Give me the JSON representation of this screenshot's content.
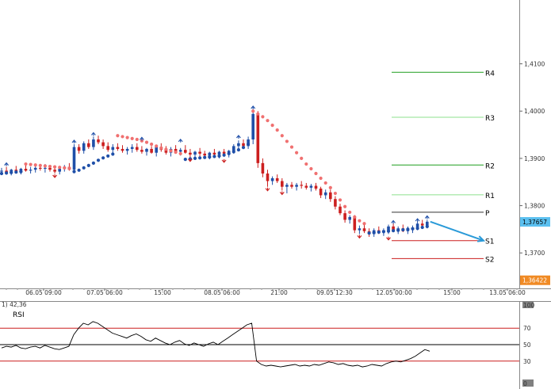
{
  "chart_data": {
    "type": "candlestick",
    "instrument": "",
    "price_axis": {
      "ticks": [
        "1,4100",
        "1,4000",
        "1,3900",
        "1,3800",
        "1,3700"
      ],
      "range": [
        1.3625,
        1.4235
      ]
    },
    "time_axis": {
      "ticks": [
        "06.05 09:00",
        "07.05 06:00",
        "15:00",
        "08.05 06:00",
        "21:00",
        "09.05 12:30",
        "12.05 00:00",
        "15:00",
        "13.05 06:00"
      ]
    },
    "current_price": {
      "label": "1,37657",
      "color": "#5bc0f0"
    },
    "marker_price": {
      "label": "1,36422",
      "color": "#f08a24"
    },
    "pivot_levels": [
      {
        "name": "R4",
        "value": 1.4082,
        "color": "#1e9e1e"
      },
      {
        "name": "R3",
        "value": 1.3987,
        "color": "#8ee08e"
      },
      {
        "name": "R2",
        "value": 1.3886,
        "color": "#1e9e1e"
      },
      {
        "name": "R1",
        "value": 1.3823,
        "color": "#8ee08e"
      },
      {
        "name": "P",
        "value": 1.3786,
        "color": "#333333"
      },
      {
        "name": "S1",
        "value": 1.3726,
        "color": "#cc1f1f"
      },
      {
        "name": "S2",
        "value": 1.3688,
        "color": "#cc1f1f"
      }
    ],
    "series": [
      {
        "kind": "ohlc",
        "up_color": "#1f4fa8",
        "down_color": "#cc1f1f",
        "bars": [
          [
            1.3872,
            1.388,
            1.3866,
            1.3874
          ],
          [
            1.3874,
            1.3882,
            1.3868,
            1.387
          ],
          [
            1.387,
            1.3878,
            1.3864,
            1.3876
          ],
          [
            1.3876,
            1.3884,
            1.387,
            1.3872
          ],
          [
            1.3872,
            1.388,
            1.3866,
            1.3878
          ],
          [
            1.3878,
            1.3886,
            1.3872,
            1.3874
          ],
          [
            1.3874,
            1.3882,
            1.3868,
            1.3876
          ],
          [
            1.3876,
            1.3884,
            1.387,
            1.388
          ],
          [
            1.388,
            1.3888,
            1.3874,
            1.3878
          ],
          [
            1.3878,
            1.3888,
            1.387,
            1.388
          ],
          [
            1.388,
            1.3886,
            1.3872,
            1.3876
          ],
          [
            1.3876,
            1.3882,
            1.3868,
            1.3872
          ],
          [
            1.3872,
            1.388,
            1.3866,
            1.3878
          ],
          [
            1.3878,
            1.3886,
            1.3872,
            1.3882
          ],
          [
            1.3882,
            1.389,
            1.3874,
            1.3876
          ],
          [
            1.3876,
            1.393,
            1.387,
            1.3924
          ],
          [
            1.3924,
            1.393,
            1.391,
            1.3916
          ],
          [
            1.3916,
            1.3936,
            1.391,
            1.3932
          ],
          [
            1.3932,
            1.394,
            1.392,
            1.3924
          ],
          [
            1.3924,
            1.3946,
            1.3918,
            1.394
          ],
          [
            1.394,
            1.3948,
            1.393,
            1.3934
          ],
          [
            1.3934,
            1.394,
            1.392,
            1.3926
          ],
          [
            1.3926,
            1.3934,
            1.3914,
            1.3918
          ],
          [
            1.3918,
            1.393,
            1.391,
            1.3924
          ],
          [
            1.3924,
            1.3932,
            1.3916,
            1.392
          ],
          [
            1.392,
            1.3928,
            1.3912,
            1.3916
          ],
          [
            1.3916,
            1.3924,
            1.3908,
            1.392
          ],
          [
            1.392,
            1.393,
            1.3912,
            1.3924
          ],
          [
            1.3924,
            1.3932,
            1.3914,
            1.3918
          ],
          [
            1.3918,
            1.3926,
            1.391,
            1.3914
          ],
          [
            1.3914,
            1.3922,
            1.3906,
            1.392
          ],
          [
            1.392,
            1.3926,
            1.391,
            1.3912
          ],
          [
            1.3912,
            1.3928,
            1.3904,
            1.3924
          ],
          [
            1.3924,
            1.3932,
            1.3914,
            1.3918
          ],
          [
            1.3918,
            1.3926,
            1.3908,
            1.3912
          ],
          [
            1.3912,
            1.3924,
            1.3904,
            1.392
          ],
          [
            1.392,
            1.3928,
            1.391,
            1.3914
          ],
          [
            1.3914,
            1.3922,
            1.3906,
            1.3918
          ],
          [
            1.3918,
            1.3928,
            1.391,
            1.3912
          ],
          [
            1.3912,
            1.392,
            1.3902,
            1.3908
          ],
          [
            1.3908,
            1.3916,
            1.39,
            1.3914
          ],
          [
            1.3914,
            1.3922,
            1.3904,
            1.391
          ],
          [
            1.391,
            1.3916,
            1.39,
            1.3906
          ],
          [
            1.3906,
            1.3914,
            1.3898,
            1.3912
          ],
          [
            1.3912,
            1.392,
            1.3902,
            1.3908
          ],
          [
            1.3908,
            1.3916,
            1.39,
            1.3914
          ],
          [
            1.3914,
            1.392,
            1.3904,
            1.391
          ],
          [
            1.391,
            1.3918,
            1.3902,
            1.3916
          ],
          [
            1.3916,
            1.393,
            1.391,
            1.3926
          ],
          [
            1.3926,
            1.3938,
            1.3918,
            1.3932
          ],
          [
            1.3932,
            1.394,
            1.3922,
            1.3926
          ],
          [
            1.3926,
            1.3946,
            1.392,
            1.394
          ],
          [
            1.394,
            1.4002,
            1.393,
            1.3994
          ],
          [
            1.3994,
            1.4,
            1.388,
            1.389
          ],
          [
            1.389,
            1.39,
            1.386,
            1.3868
          ],
          [
            1.3868,
            1.3876,
            1.384,
            1.3852
          ],
          [
            1.3852,
            1.3862,
            1.3844,
            1.3858
          ],
          [
            1.3858,
            1.3866,
            1.3848,
            1.3852
          ],
          [
            1.3852,
            1.3858,
            1.3832,
            1.384
          ],
          [
            1.384,
            1.3848,
            1.3826,
            1.3844
          ],
          [
            1.3844,
            1.385,
            1.3836,
            1.384
          ],
          [
            1.384,
            1.3848,
            1.3832,
            1.3844
          ],
          [
            1.3844,
            1.3852,
            1.3836,
            1.3842
          ],
          [
            1.3842,
            1.3848,
            1.3834,
            1.3838
          ],
          [
            1.3838,
            1.3846,
            1.383,
            1.3842
          ],
          [
            1.3842,
            1.3848,
            1.3832,
            1.3836
          ],
          [
            1.3836,
            1.384,
            1.3816,
            1.3822
          ],
          [
            1.3822,
            1.3834,
            1.3814,
            1.3828
          ],
          [
            1.3828,
            1.3834,
            1.3808,
            1.3814
          ],
          [
            1.3814,
            1.382,
            1.3792,
            1.3798
          ],
          [
            1.3798,
            1.3804,
            1.378,
            1.3784
          ],
          [
            1.3784,
            1.379,
            1.3764,
            1.377
          ],
          [
            1.377,
            1.378,
            1.3762,
            1.3776
          ],
          [
            1.3776,
            1.378,
            1.3742,
            1.3748
          ],
          [
            1.3748,
            1.3758,
            1.374,
            1.3752
          ],
          [
            1.3752,
            1.376,
            1.3742,
            1.3746
          ],
          [
            1.3746,
            1.3752,
            1.3734,
            1.374
          ],
          [
            1.374,
            1.3752,
            1.3734,
            1.3748
          ],
          [
            1.3748,
            1.3756,
            1.374,
            1.3744
          ],
          [
            1.3744,
            1.3752,
            1.3736,
            1.3748
          ],
          [
            1.3748,
            1.376,
            1.374,
            1.3756
          ],
          [
            1.3756,
            1.3762,
            1.3744,
            1.3748
          ],
          [
            1.3748,
            1.3756,
            1.374,
            1.3752
          ],
          [
            1.3752,
            1.376,
            1.3744,
            1.3746
          ],
          [
            1.3746,
            1.3756,
            1.374,
            1.375
          ],
          [
            1.375,
            1.3758,
            1.3742,
            1.3754
          ],
          [
            1.3754,
            1.3766,
            1.3748,
            1.3762
          ],
          [
            1.3762,
            1.377,
            1.3754,
            1.3758
          ],
          [
            1.3758,
            1.377,
            1.3752,
            1.3766
          ]
        ]
      },
      {
        "kind": "psar_up",
        "color": "#1f4fa8",
        "points": [
          [
            0,
            1.3868
          ],
          [
            1,
            1.3869
          ],
          [
            2,
            1.387
          ],
          [
            3,
            1.3871
          ],
          [
            4,
            1.3872
          ],
          [
            15,
            1.3872
          ],
          [
            16,
            1.3875
          ],
          [
            17,
            1.388
          ],
          [
            18,
            1.3885
          ],
          [
            19,
            1.389
          ],
          [
            20,
            1.3896
          ],
          [
            21,
            1.3901
          ],
          [
            22,
            1.3905
          ],
          [
            23,
            1.3909
          ],
          [
            38,
            1.3898
          ],
          [
            39,
            1.3899
          ],
          [
            40,
            1.39
          ],
          [
            41,
            1.3901
          ],
          [
            42,
            1.3902
          ],
          [
            43,
            1.3903
          ],
          [
            44,
            1.3904
          ],
          [
            45,
            1.3905
          ],
          [
            46,
            1.3907
          ],
          [
            47,
            1.391
          ],
          [
            48,
            1.3914
          ],
          [
            49,
            1.3918
          ],
          [
            50,
            1.3923
          ],
          [
            51,
            1.393
          ],
          [
            76,
            1.3742
          ],
          [
            77,
            1.3743
          ],
          [
            78,
            1.3744
          ],
          [
            79,
            1.3745
          ],
          [
            80,
            1.3746
          ],
          [
            81,
            1.3747
          ],
          [
            82,
            1.3748
          ],
          [
            83,
            1.3749
          ],
          [
            84,
            1.375
          ],
          [
            85,
            1.3751
          ],
          [
            86,
            1.3752
          ],
          [
            87,
            1.3754
          ],
          [
            88,
            1.3756
          ]
        ]
      },
      {
        "kind": "psar_down",
        "color": "#f07070",
        "points": [
          [
            5,
            1.3888
          ],
          [
            6,
            1.3887
          ],
          [
            7,
            1.3886
          ],
          [
            8,
            1.3885
          ],
          [
            9,
            1.3884
          ],
          [
            10,
            1.3883
          ],
          [
            11,
            1.3882
          ],
          [
            12,
            1.3881
          ],
          [
            13,
            1.388
          ],
          [
            14,
            1.3879
          ],
          [
            24,
            1.3948
          ],
          [
            25,
            1.3946
          ],
          [
            26,
            1.3944
          ],
          [
            27,
            1.3942
          ],
          [
            28,
            1.394
          ],
          [
            29,
            1.3937
          ],
          [
            30,
            1.3934
          ],
          [
            31,
            1.393
          ],
          [
            32,
            1.3926
          ],
          [
            33,
            1.3922
          ],
          [
            34,
            1.3919
          ],
          [
            35,
            1.3916
          ],
          [
            36,
            1.3913
          ],
          [
            37,
            1.391
          ],
          [
            52,
            1.4
          ],
          [
            53,
            1.3994
          ],
          [
            54,
            1.3988
          ],
          [
            55,
            1.398
          ],
          [
            56,
            1.397
          ],
          [
            57,
            1.396
          ],
          [
            58,
            1.3948
          ],
          [
            59,
            1.3936
          ],
          [
            60,
            1.3924
          ],
          [
            61,
            1.3912
          ],
          [
            62,
            1.39
          ],
          [
            63,
            1.3888
          ],
          [
            64,
            1.3878
          ],
          [
            65,
            1.3868
          ],
          [
            66,
            1.3858
          ],
          [
            67,
            1.3848
          ],
          [
            68,
            1.3838
          ],
          [
            69,
            1.3826
          ],
          [
            70,
            1.3812
          ],
          [
            71,
            1.3798
          ],
          [
            72,
            1.3786
          ],
          [
            73,
            1.3776
          ],
          [
            74,
            1.3768
          ],
          [
            75,
            1.3762
          ]
        ]
      },
      {
        "kind": "fractal_up",
        "color": "#1f4fa8",
        "points": [
          [
            1,
            1.3882
          ],
          [
            15,
            1.393
          ],
          [
            19,
            1.3946
          ],
          [
            29,
            1.3936
          ],
          [
            37,
            1.3932
          ],
          [
            49,
            1.394
          ],
          [
            52,
            1.4002
          ],
          [
            81,
            1.376
          ],
          [
            86,
            1.3764
          ],
          [
            88,
            1.377
          ]
        ]
      },
      {
        "kind": "fractal_down",
        "color": "#cc1f1f",
        "points": [
          [
            11,
            1.3868
          ],
          [
            39,
            1.3902
          ],
          [
            46,
            1.39
          ],
          [
            55,
            1.384
          ],
          [
            58,
            1.3832
          ],
          [
            74,
            1.374
          ],
          [
            80,
            1.3736
          ]
        ]
      }
    ],
    "forecast_arrow": {
      "from": [
        88,
        1.3766
      ],
      "to": [
        105,
        1.3726
      ],
      "color": "#2a9ad8"
    },
    "indicator": {
      "name": "RSI",
      "header": "1) 42,36",
      "ticks": [
        "100",
        "70",
        "50",
        "30",
        "0"
      ],
      "range": [
        0,
        100
      ],
      "levels": [
        {
          "value": 70,
          "color": "#cc1f1f"
        },
        {
          "value": 50,
          "color": "#000000"
        },
        {
          "value": 30,
          "color": "#cc1f1f"
        }
      ],
      "values": [
        46,
        48,
        47,
        49,
        46,
        45,
        47,
        48,
        46,
        49,
        47,
        45,
        44,
        46,
        48,
        62,
        70,
        76,
        74,
        78,
        76,
        72,
        68,
        64,
        62,
        60,
        58,
        61,
        63,
        60,
        56,
        54,
        58,
        55,
        52,
        50,
        53,
        55,
        51,
        49,
        52,
        50,
        48,
        51,
        53,
        50,
        54,
        58,
        62,
        66,
        70,
        74,
        76,
        30,
        26,
        24,
        25,
        24,
        23,
        24,
        25,
        26,
        24,
        25,
        24,
        26,
        25,
        27,
        29,
        28,
        26,
        27,
        25,
        24,
        25,
        23,
        24,
        26,
        25,
        24,
        27,
        29,
        30,
        29,
        31,
        33,
        36,
        40,
        44,
        42
      ]
    }
  }
}
